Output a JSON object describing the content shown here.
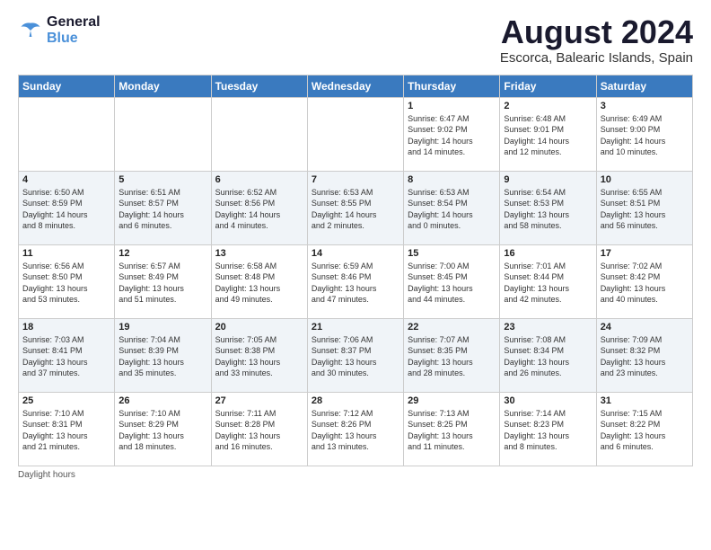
{
  "logo": {
    "line1": "General",
    "line2": "Blue"
  },
  "title": "August 2024",
  "location": "Escorca, Balearic Islands, Spain",
  "days_of_week": [
    "Sunday",
    "Monday",
    "Tuesday",
    "Wednesday",
    "Thursday",
    "Friday",
    "Saturday"
  ],
  "footer": "Daylight hours",
  "weeks": [
    [
      {
        "day": "",
        "info": ""
      },
      {
        "day": "",
        "info": ""
      },
      {
        "day": "",
        "info": ""
      },
      {
        "day": "",
        "info": ""
      },
      {
        "day": "1",
        "info": "Sunrise: 6:47 AM\nSunset: 9:02 PM\nDaylight: 14 hours\nand 14 minutes."
      },
      {
        "day": "2",
        "info": "Sunrise: 6:48 AM\nSunset: 9:01 PM\nDaylight: 14 hours\nand 12 minutes."
      },
      {
        "day": "3",
        "info": "Sunrise: 6:49 AM\nSunset: 9:00 PM\nDaylight: 14 hours\nand 10 minutes."
      }
    ],
    [
      {
        "day": "4",
        "info": "Sunrise: 6:50 AM\nSunset: 8:59 PM\nDaylight: 14 hours\nand 8 minutes."
      },
      {
        "day": "5",
        "info": "Sunrise: 6:51 AM\nSunset: 8:57 PM\nDaylight: 14 hours\nand 6 minutes."
      },
      {
        "day": "6",
        "info": "Sunrise: 6:52 AM\nSunset: 8:56 PM\nDaylight: 14 hours\nand 4 minutes."
      },
      {
        "day": "7",
        "info": "Sunrise: 6:53 AM\nSunset: 8:55 PM\nDaylight: 14 hours\nand 2 minutes."
      },
      {
        "day": "8",
        "info": "Sunrise: 6:53 AM\nSunset: 8:54 PM\nDaylight: 14 hours\nand 0 minutes."
      },
      {
        "day": "9",
        "info": "Sunrise: 6:54 AM\nSunset: 8:53 PM\nDaylight: 13 hours\nand 58 minutes."
      },
      {
        "day": "10",
        "info": "Sunrise: 6:55 AM\nSunset: 8:51 PM\nDaylight: 13 hours\nand 56 minutes."
      }
    ],
    [
      {
        "day": "11",
        "info": "Sunrise: 6:56 AM\nSunset: 8:50 PM\nDaylight: 13 hours\nand 53 minutes."
      },
      {
        "day": "12",
        "info": "Sunrise: 6:57 AM\nSunset: 8:49 PM\nDaylight: 13 hours\nand 51 minutes."
      },
      {
        "day": "13",
        "info": "Sunrise: 6:58 AM\nSunset: 8:48 PM\nDaylight: 13 hours\nand 49 minutes."
      },
      {
        "day": "14",
        "info": "Sunrise: 6:59 AM\nSunset: 8:46 PM\nDaylight: 13 hours\nand 47 minutes."
      },
      {
        "day": "15",
        "info": "Sunrise: 7:00 AM\nSunset: 8:45 PM\nDaylight: 13 hours\nand 44 minutes."
      },
      {
        "day": "16",
        "info": "Sunrise: 7:01 AM\nSunset: 8:44 PM\nDaylight: 13 hours\nand 42 minutes."
      },
      {
        "day": "17",
        "info": "Sunrise: 7:02 AM\nSunset: 8:42 PM\nDaylight: 13 hours\nand 40 minutes."
      }
    ],
    [
      {
        "day": "18",
        "info": "Sunrise: 7:03 AM\nSunset: 8:41 PM\nDaylight: 13 hours\nand 37 minutes."
      },
      {
        "day": "19",
        "info": "Sunrise: 7:04 AM\nSunset: 8:39 PM\nDaylight: 13 hours\nand 35 minutes."
      },
      {
        "day": "20",
        "info": "Sunrise: 7:05 AM\nSunset: 8:38 PM\nDaylight: 13 hours\nand 33 minutes."
      },
      {
        "day": "21",
        "info": "Sunrise: 7:06 AM\nSunset: 8:37 PM\nDaylight: 13 hours\nand 30 minutes."
      },
      {
        "day": "22",
        "info": "Sunrise: 7:07 AM\nSunset: 8:35 PM\nDaylight: 13 hours\nand 28 minutes."
      },
      {
        "day": "23",
        "info": "Sunrise: 7:08 AM\nSunset: 8:34 PM\nDaylight: 13 hours\nand 26 minutes."
      },
      {
        "day": "24",
        "info": "Sunrise: 7:09 AM\nSunset: 8:32 PM\nDaylight: 13 hours\nand 23 minutes."
      }
    ],
    [
      {
        "day": "25",
        "info": "Sunrise: 7:10 AM\nSunset: 8:31 PM\nDaylight: 13 hours\nand 21 minutes."
      },
      {
        "day": "26",
        "info": "Sunrise: 7:10 AM\nSunset: 8:29 PM\nDaylight: 13 hours\nand 18 minutes."
      },
      {
        "day": "27",
        "info": "Sunrise: 7:11 AM\nSunset: 8:28 PM\nDaylight: 13 hours\nand 16 minutes."
      },
      {
        "day": "28",
        "info": "Sunrise: 7:12 AM\nSunset: 8:26 PM\nDaylight: 13 hours\nand 13 minutes."
      },
      {
        "day": "29",
        "info": "Sunrise: 7:13 AM\nSunset: 8:25 PM\nDaylight: 13 hours\nand 11 minutes."
      },
      {
        "day": "30",
        "info": "Sunrise: 7:14 AM\nSunset: 8:23 PM\nDaylight: 13 hours\nand 8 minutes."
      },
      {
        "day": "31",
        "info": "Sunrise: 7:15 AM\nSunset: 8:22 PM\nDaylight: 13 hours\nand 6 minutes."
      }
    ]
  ]
}
